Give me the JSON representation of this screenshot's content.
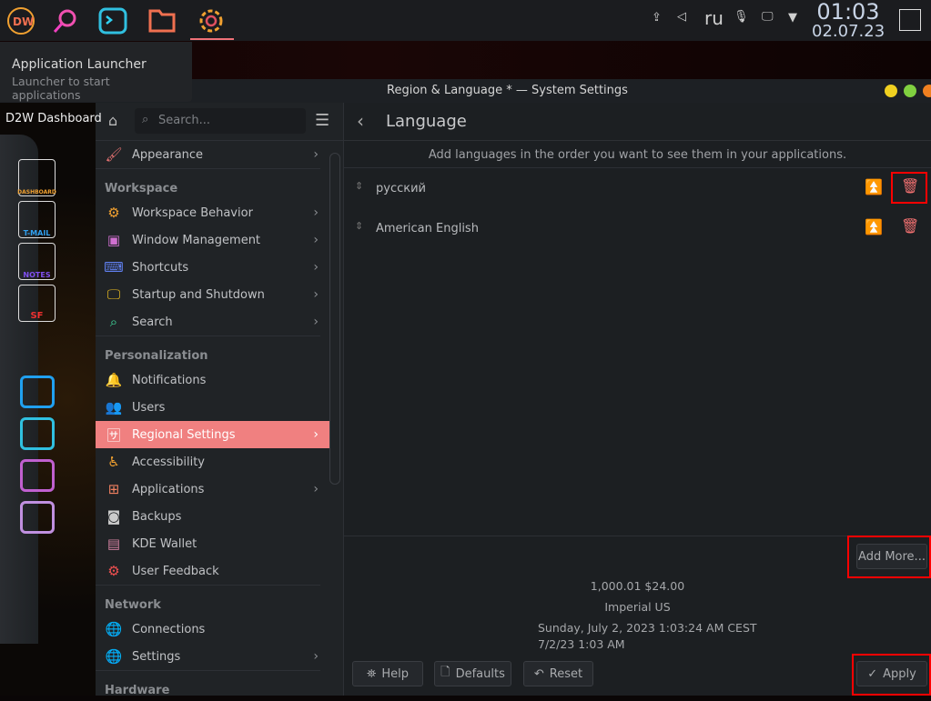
{
  "taskbar": {
    "icons": [
      "d2w-launcher-icon",
      "search-icon",
      "terminal-icon",
      "folder-icon",
      "settings-gear-icon"
    ],
    "keyboard_layout": "ru",
    "time": "01:03",
    "date": "02.07.23"
  },
  "tooltip": {
    "title": "Application Launcher",
    "subtitle": "Launcher to start applications"
  },
  "window": {
    "title": "Region & Language * — System Settings"
  },
  "dock": {
    "label": "D2W Dashboard",
    "tiles": [
      "DASHBOARD",
      "T-MAIL",
      "NOTES",
      "SF"
    ]
  },
  "sidebar": {
    "search_placeholder": "Search...",
    "sections": [
      {
        "header": "",
        "items": [
          {
            "label": "Appearance",
            "icon": "paintbrush-icon",
            "arrow": true
          }
        ]
      },
      {
        "header": "Workspace",
        "items": [
          {
            "label": "Workspace Behavior",
            "icon": "gear-icon",
            "arrow": true
          },
          {
            "label": "Window Management",
            "icon": "window-icon",
            "arrow": true
          },
          {
            "label": "Shortcuts",
            "icon": "keyboard-icon",
            "arrow": true
          },
          {
            "label": "Startup and Shutdown",
            "icon": "monitor-power-icon",
            "arrow": true
          },
          {
            "label": "Search",
            "icon": "search-icon",
            "arrow": true
          }
        ]
      },
      {
        "header": "Personalization",
        "items": [
          {
            "label": "Notifications",
            "icon": "bell-icon",
            "arrow": false
          },
          {
            "label": "Users",
            "icon": "users-icon",
            "arrow": false
          },
          {
            "label": "Regional Settings",
            "icon": "language-icon",
            "arrow": true,
            "selected": true
          },
          {
            "label": "Accessibility",
            "icon": "accessibility-icon",
            "arrow": false
          },
          {
            "label": "Applications",
            "icon": "apps-grid-icon",
            "arrow": true
          },
          {
            "label": "Backups",
            "icon": "backup-icon",
            "arrow": false
          },
          {
            "label": "KDE Wallet",
            "icon": "wallet-icon",
            "arrow": false
          },
          {
            "label": "User Feedback",
            "icon": "feedback-gear-icon",
            "arrow": false
          }
        ]
      },
      {
        "header": "Network",
        "items": [
          {
            "label": "Connections",
            "icon": "globe-icon",
            "arrow": false
          },
          {
            "label": "Settings",
            "icon": "globe-icon",
            "arrow": true
          }
        ]
      },
      {
        "header": "Hardware",
        "items": []
      }
    ]
  },
  "content": {
    "title": "Language",
    "hint": "Add languages in the order you want to see them in your applications.",
    "languages": [
      "русский",
      "American English"
    ],
    "add_more": "Add More...",
    "preview": {
      "numbers": "1,000.01  $24.00",
      "measurement": "Imperial US",
      "long_date": "Sunday, July 2, 2023 1:03:24 AM CEST",
      "short_date": "7/2/23 1:03 AM"
    },
    "buttons": {
      "help": "Help",
      "defaults": "Defaults",
      "reset": "Reset",
      "apply": "Apply"
    }
  },
  "colors": {
    "accent": "#f08080",
    "highlight_box": "#ff0000",
    "delete": "#f07070"
  }
}
